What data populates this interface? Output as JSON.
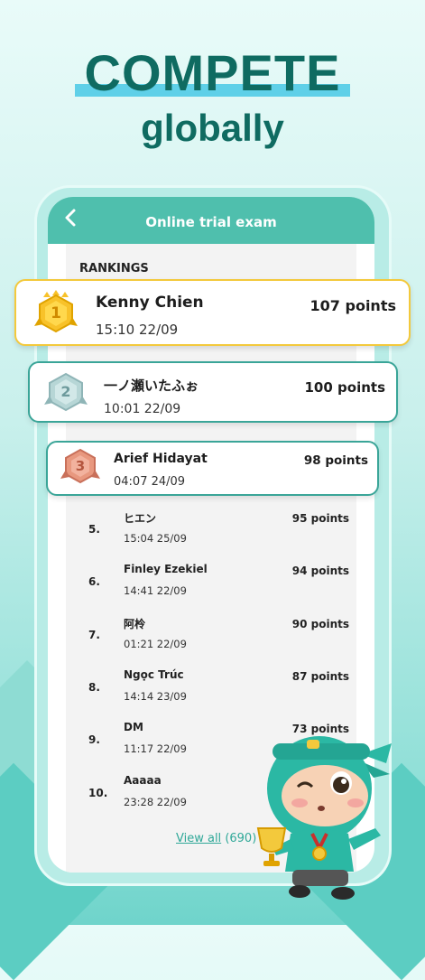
{
  "hero": {
    "title": "COMPETE",
    "subtitle": "globally"
  },
  "header": {
    "title": "Online trial exam"
  },
  "rankings_label": "RANKINGS",
  "top_entries": [
    {
      "rank": "1",
      "name": "Kenny Chien",
      "time": "15:10 22/09",
      "points": "107 points"
    },
    {
      "rank": "2",
      "name": "一ノ瀬いたふぉ",
      "time": "10:01 22/09",
      "points": "100 points"
    },
    {
      "rank": "3",
      "name": "Arief Hidayat",
      "time": "04:07 24/09",
      "points": "98 points"
    }
  ],
  "entries": [
    {
      "rank": "5.",
      "name": "ヒエン",
      "time": "15:04 25/09",
      "points": "95 points"
    },
    {
      "rank": "6.",
      "name": "Finley Ezekiel",
      "time": "14:41 22/09",
      "points": "94 points"
    },
    {
      "rank": "7.",
      "name": "阿柃",
      "time": "01:21 22/09",
      "points": "90 points"
    },
    {
      "rank": "8.",
      "name": "Ngọc Trúc",
      "time": "14:14 23/09",
      "points": "87 points"
    },
    {
      "rank": "9.",
      "name": "DM",
      "time": "11:17 22/09",
      "points": "73 points"
    },
    {
      "rank": "10.",
      "name": "Aaaaa",
      "time": "23:28 22/09",
      "points": ""
    }
  ],
  "view_all": {
    "label": "View all",
    "count": "(690)"
  },
  "colors": {
    "brand": "#4fbfad",
    "gold": "#f3c93c",
    "teal_border": "#3aa598",
    "title": "#0f6b61"
  },
  "icons": {
    "back": "chevron-left-icon",
    "badge1": "gold-hexagon-badge-icon",
    "badge2": "silver-hexagon-badge-icon",
    "badge3": "bronze-hexagon-badge-icon"
  }
}
